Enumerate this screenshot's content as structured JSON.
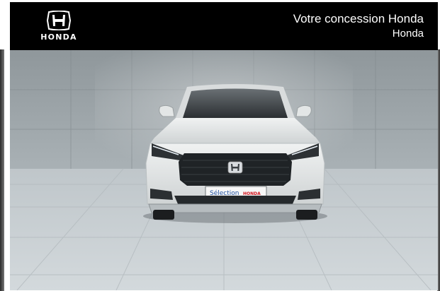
{
  "brand": {
    "wordmark": "HONDA",
    "logo_icon": "honda-h-logo-icon"
  },
  "dealer": {
    "title": "Votre concession Honda",
    "subtitle": "Honda"
  },
  "photo": {
    "subject": "front view of a white SUV in a grey concrete studio",
    "plate_text": "Sélection",
    "plate_brand": "HONDA",
    "colors": {
      "header_bg": "#000000",
      "wall": "#9ba3a7",
      "floor": "#c7ced2",
      "car_body": "#e3e6e6",
      "plate_red": "#d0121b"
    }
  }
}
